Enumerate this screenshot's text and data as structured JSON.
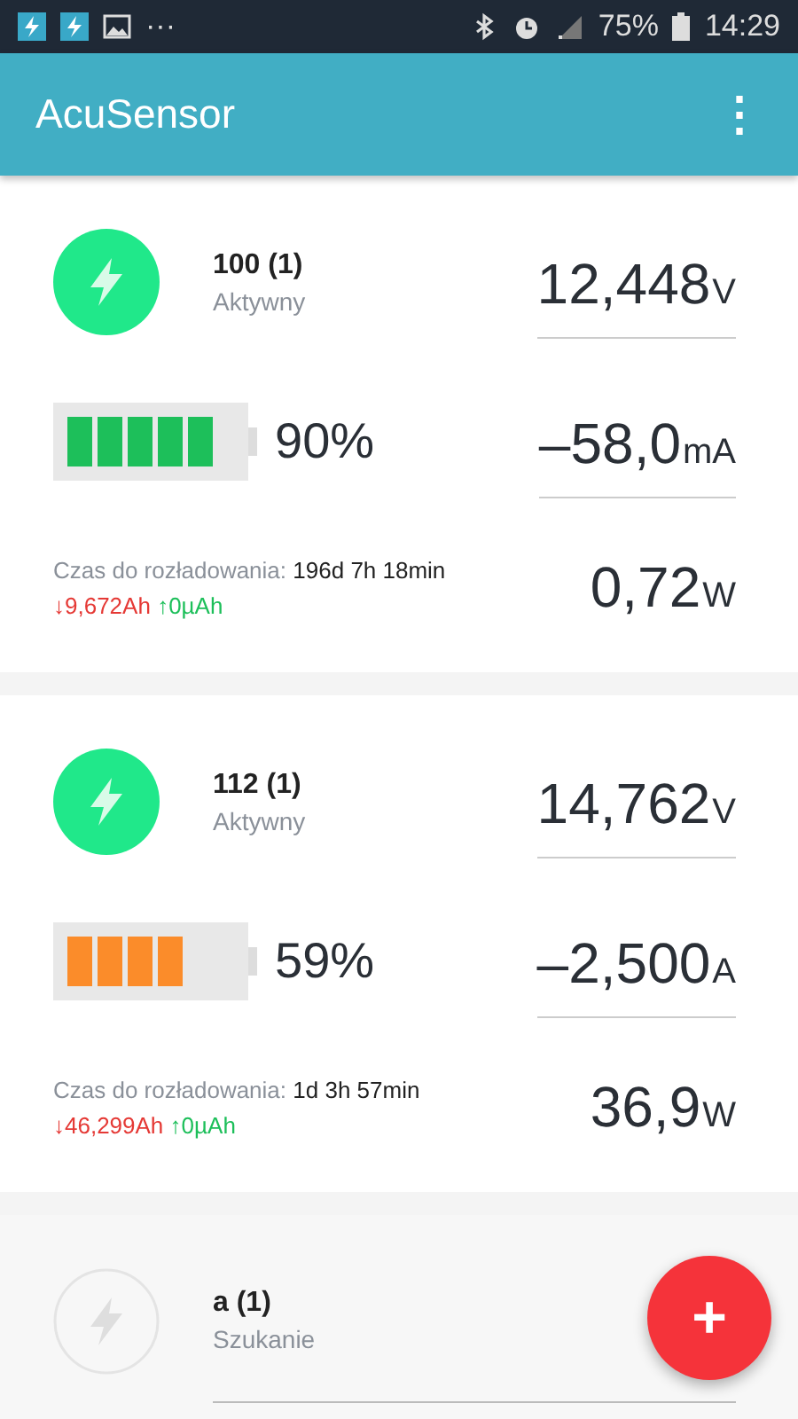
{
  "status_bar": {
    "overflow": "···",
    "battery": "75%",
    "time": "14:29"
  },
  "app_bar": {
    "title": "AcuSensor",
    "menu": "⋮"
  },
  "devices": [
    {
      "kind": "active",
      "name": "100 (1)",
      "status": "Aktywny",
      "voltage": {
        "value": "12,448",
        "unit": "V"
      },
      "battery": {
        "kind": "high",
        "color": "#1dbf5a",
        "reading": "90%"
      },
      "current": {
        "value": "–58,0",
        "unit": "mA"
      },
      "discharge_label": "Czas do rozładowania:",
      "discharge_time": "196d 7h 18min",
      "drawn": "↓9,672Ah",
      "charged": "↑0µAh",
      "power": {
        "value": "0,72",
        "unit": "W"
      }
    },
    {
      "kind": "active",
      "name": "112 (1)",
      "status": "Aktywny",
      "voltage": {
        "value": "14,762",
        "unit": "V"
      },
      "battery": {
        "kind": "medium",
        "color": "#fb8c2a",
        "reading": "59%"
      },
      "current": {
        "value": "–2,500",
        "unit": "A"
      },
      "discharge_label": "Czas do rozładowania:",
      "discharge_time": "1d 3h 57min",
      "drawn": "↓46,299Ah",
      "charged": "↑0µAh",
      "power": {
        "value": "36,9",
        "unit": "W"
      }
    },
    {
      "kind": "searching",
      "name": "a (1)",
      "status": "Szukanie"
    }
  ],
  "fab": {
    "label": "+"
  }
}
